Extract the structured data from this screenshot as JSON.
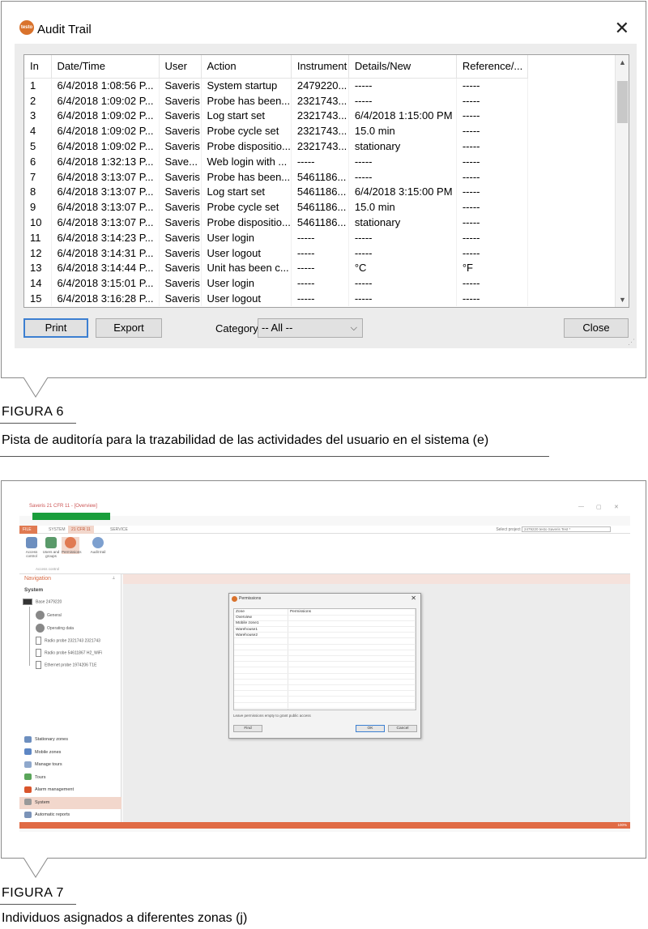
{
  "figure6": {
    "window_title": "Audit Trail",
    "logo_text": "testo",
    "close_glyph": "✕",
    "columns": [
      "In",
      "Date/Time",
      "User",
      "Action",
      "Instrument",
      "Details/New",
      "Reference/..."
    ],
    "rows": [
      [
        "1",
        "6/4/2018 1:08:56 P...",
        "Saveris",
        "System startup",
        "2479220...",
        "-----",
        "-----"
      ],
      [
        "2",
        "6/4/2018 1:09:02 P...",
        "Saveris",
        "Probe has been...",
        "2321743...",
        "-----",
        "-----"
      ],
      [
        "3",
        "6/4/2018 1:09:02 P...",
        "Saveris",
        "Log start set",
        "2321743...",
        "6/4/2018 1:15:00 PM",
        "-----"
      ],
      [
        "4",
        "6/4/2018 1:09:02 P...",
        "Saveris",
        "Probe cycle set",
        "2321743...",
        "15.0 min",
        "-----"
      ],
      [
        "5",
        "6/4/2018 1:09:02 P...",
        "Saveris",
        "Probe dispositio...",
        "2321743...",
        "stationary",
        "-----"
      ],
      [
        "6",
        "6/4/2018 1:32:13 P...",
        "Save...",
        "Web login with ...",
        "-----",
        "-----",
        "-----"
      ],
      [
        "7",
        "6/4/2018 3:13:07 P...",
        "Saveris",
        "Probe has been...",
        "5461186...",
        "-----",
        "-----"
      ],
      [
        "8",
        "6/4/2018 3:13:07 P...",
        "Saveris",
        "Log start set",
        "5461186...",
        "6/4/2018 3:15:00 PM",
        "-----"
      ],
      [
        "9",
        "6/4/2018 3:13:07 P...",
        "Saveris",
        "Probe cycle set",
        "5461186...",
        "15.0 min",
        "-----"
      ],
      [
        "10",
        "6/4/2018 3:13:07 P...",
        "Saveris",
        "Probe dispositio...",
        "5461186...",
        "stationary",
        "-----"
      ],
      [
        "11",
        "6/4/2018 3:14:23 P...",
        "Saveris",
        "User login",
        "-----",
        "-----",
        "-----"
      ],
      [
        "12",
        "6/4/2018 3:14:31 P...",
        "Saveris",
        "User logout",
        "-----",
        "-----",
        "-----"
      ],
      [
        "13",
        "6/4/2018 3:14:44 P...",
        "Saveris",
        "Unit has been c...",
        "-----",
        "°C",
        "°F"
      ],
      [
        "14",
        "6/4/2018 3:15:01 P...",
        "Saveris",
        "User login",
        "-----",
        "-----",
        "-----"
      ],
      [
        "15",
        "6/4/2018 3:16:28 P...",
        "Saveris",
        "User logout",
        "-----",
        "-----",
        "-----"
      ]
    ],
    "buttons": {
      "print": "Print",
      "export": "Export",
      "close": "Close"
    },
    "category_label": "Category",
    "category_value": "-- All --",
    "caption_title": "FIGURA 6",
    "caption_text": "Pista de auditoría para la trazabilidad de las actividades del usuario en el sistema (e)"
  },
  "figure7": {
    "window_title": "Saveris 21 CFR 11 - [Overview]",
    "tabs": [
      "FILE",
      "SYSTEM",
      "21 CFR 11",
      "SERVICE"
    ],
    "project_label": "Select project",
    "project_value": "2479220 testo Saveris Test *",
    "ribbon_buttons": [
      "Access control",
      "Users and groups",
      "Permissions",
      "Audit trail"
    ],
    "ribbon_group": "Access control",
    "nav_header": "Navigation",
    "nav_system": "System",
    "tree": [
      "Base 2479220",
      "General",
      "Operating data",
      "Radio probe 2321743 2321743",
      "Radio probe 54611867 H2_WiFi",
      "Ethernet probe 1974206 T1E"
    ],
    "nav_items": [
      "Stationary zones",
      "Mobile zones",
      "Manage tours",
      "Tours",
      "Alarm management",
      "System",
      "Automatic reports"
    ],
    "dialog": {
      "title": "Permissions",
      "col_zone": "Zone",
      "col_permissions": "Permissions",
      "zones": [
        "Overview",
        "Mobile zone1",
        "Warehouse1",
        "Warehouse2"
      ],
      "hint": "Leave permissions empty to grant public access",
      "find": "Find",
      "ok": "OK",
      "cancel": "Cancel"
    },
    "zoom": "100%",
    "caption_title": "FIGURA 7",
    "caption_text": "Individuos asignados a diferentes zonas (j)"
  },
  "colors": {
    "accent": "#e06b45",
    "green": "#1a9e3c",
    "selection": "#f2d7cc",
    "default_button": "#3c7fd1"
  }
}
